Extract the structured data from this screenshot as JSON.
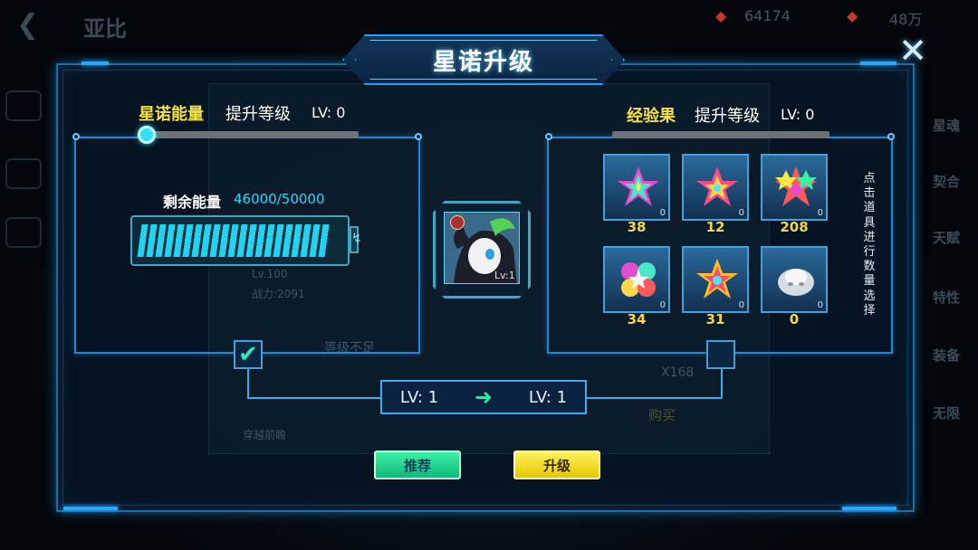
{
  "background": {
    "title": "亚比",
    "resource1": "64174",
    "resource2": "48万",
    "side_tabs": [
      "星魂",
      "契合",
      "天赋",
      "特性",
      "装备",
      "无限"
    ],
    "ghost_labels": [
      "Lv.100",
      "战力:2091",
      "等级不足",
      "X168",
      "购买",
      "穿越前瞻"
    ]
  },
  "dialog": {
    "title": "星诺升级",
    "close_label": "✕"
  },
  "left": {
    "energy_name": "星诺能量",
    "upgrade_label": "提升等级",
    "lv_label": "LV: 0",
    "slider_fraction": 0.0,
    "remaining_label": "剩余能量",
    "remaining_value": "46000/50000",
    "energy_fraction": 0.92,
    "checked": true
  },
  "avatar": {
    "level": "Lv:1"
  },
  "right": {
    "fruit_name": "经验果",
    "upgrade_label": "提升等级",
    "lv_label": "LV: 0",
    "slider_fraction": 1.0,
    "hint": "点击道具进行数量选择",
    "items": [
      {
        "count": "38",
        "selected": "0",
        "icon": "rainbow-star-gem"
      },
      {
        "count": "12",
        "selected": "0",
        "icon": "pink-star-gem"
      },
      {
        "count": "208",
        "selected": "0",
        "icon": "cluster-star-gem"
      },
      {
        "count": "34",
        "selected": "0",
        "icon": "flower-star-gem"
      },
      {
        "count": "31",
        "selected": "0",
        "icon": "gold-star-gem"
      },
      {
        "count": "0",
        "selected": "0",
        "icon": "silver-blob"
      }
    ],
    "checked": false
  },
  "level_change": {
    "from": "LV: 1",
    "to": "LV: 1"
  },
  "buttons": {
    "recommend": "推荐",
    "upgrade": "升级"
  },
  "colors": {
    "accent": "#2a9cff",
    "energy": "#20d4f0",
    "highlight": "#f4e04a",
    "green_button": "#1fd08a",
    "yellow_button": "#f0dc20"
  }
}
